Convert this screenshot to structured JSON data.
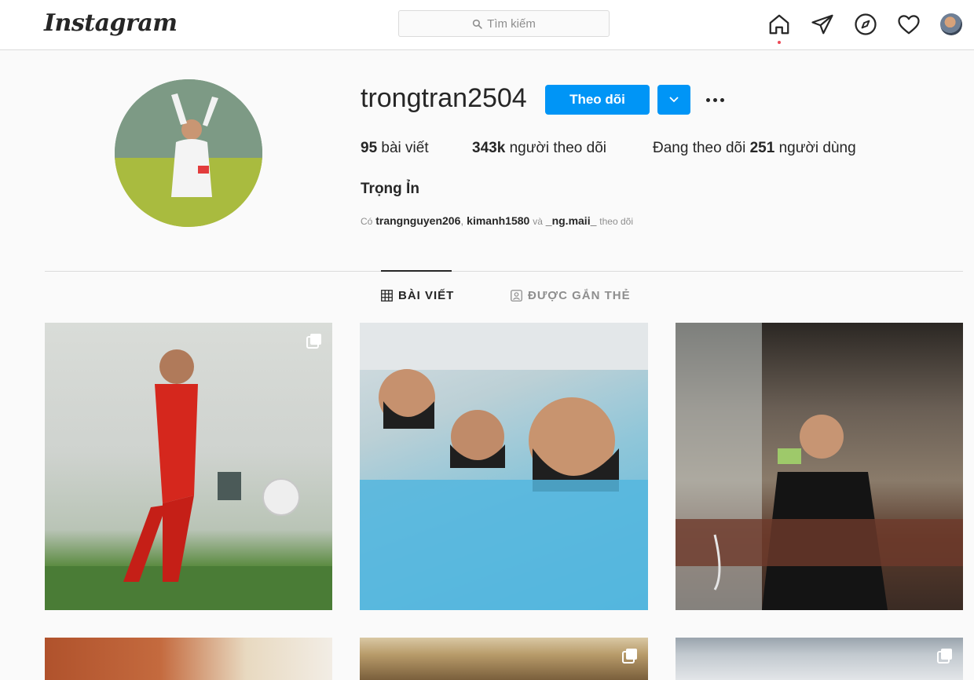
{
  "nav": {
    "logo": "Instagram",
    "search_placeholder": "Tìm kiếm",
    "icons": [
      "home-icon",
      "direct-icon",
      "explore-icon",
      "heart-icon",
      "profile-avatar"
    ],
    "notification_dot_color": "#ed4956"
  },
  "profile": {
    "username": "trongtran2504",
    "follow_label": "Theo dõi",
    "stats": {
      "posts_count": "95",
      "posts_label": "bài viết",
      "followers_count": "343k",
      "followers_label": "người theo dõi",
      "following_prefix": "Đang theo dõi",
      "following_count": "251",
      "following_label": "người dùng"
    },
    "full_name": "Trọng Ỉn",
    "followed_by": {
      "prefix": "Có",
      "account_1": "trangnguyen206",
      "sep": ",",
      "account_2": "kimanh1580",
      "and": "và",
      "account_3": "_ng.maii_",
      "suffix": "theo dõi"
    }
  },
  "tabs": [
    {
      "label": "BÀI VIẾT",
      "icon": "grid-icon",
      "active": true
    },
    {
      "label": "ĐƯỢC GẮN THẺ",
      "icon": "tagged-icon",
      "active": false
    }
  ],
  "posts": [
    {
      "type": "carousel",
      "desc": "player-red-kit"
    },
    {
      "type": "photo",
      "desc": "three-players-masks"
    },
    {
      "type": "photo",
      "desc": "restaurant-selfie"
    },
    {
      "type": "photo",
      "desc": "plant-wall"
    },
    {
      "type": "carousel",
      "desc": "building-arch"
    },
    {
      "type": "carousel",
      "desc": "sky"
    }
  ],
  "colors": {
    "accent": "#0095f6",
    "border": "#dbdbdb",
    "background": "#fafafa",
    "text": "#262626",
    "muted": "#8e8e8e"
  }
}
